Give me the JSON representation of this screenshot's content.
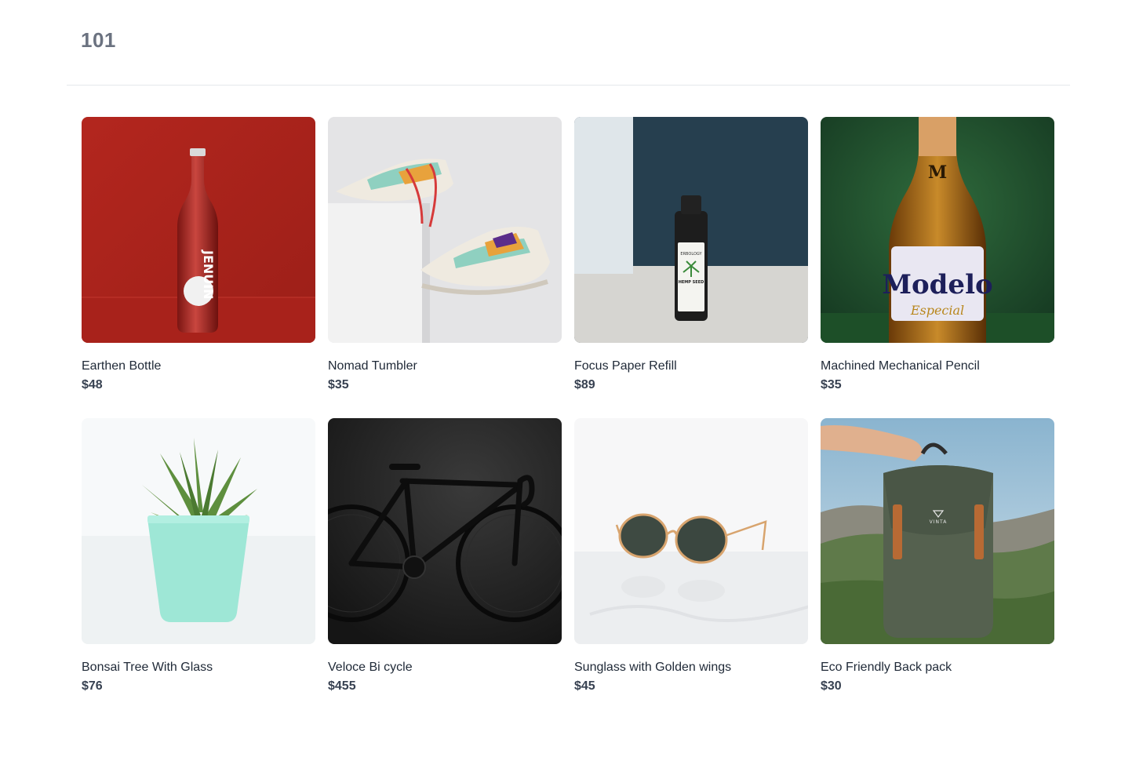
{
  "header": {
    "brand": "101"
  },
  "products": [
    {
      "name": "Earthen Bottle",
      "price": "$48",
      "image": "red-soda-bottle",
      "label": "JENUIN"
    },
    {
      "name": "Nomad Tumbler",
      "price": "$35",
      "image": "sneakers"
    },
    {
      "name": "Focus Paper Refill",
      "price": "$89",
      "image": "hemp-oil-bottle",
      "label": "ERBOLOGY",
      "sublabel": "HEMP SEED"
    },
    {
      "name": "Machined Mechanical Pencil",
      "price": "$35",
      "image": "beer-bottle",
      "label": "Modelo",
      "sublabel": "Especial"
    },
    {
      "name": "Bonsai Tree With Glass",
      "price": "$76",
      "image": "potted-succulent"
    },
    {
      "name": "Veloce Bi cycle",
      "price": "$455",
      "image": "road-bicycle"
    },
    {
      "name": "Sunglass with Golden wings",
      "price": "$45",
      "image": "sunglasses"
    },
    {
      "name": "Eco Friendly Back pack",
      "price": "$30",
      "image": "backpack",
      "label": "VINTA"
    }
  ]
}
